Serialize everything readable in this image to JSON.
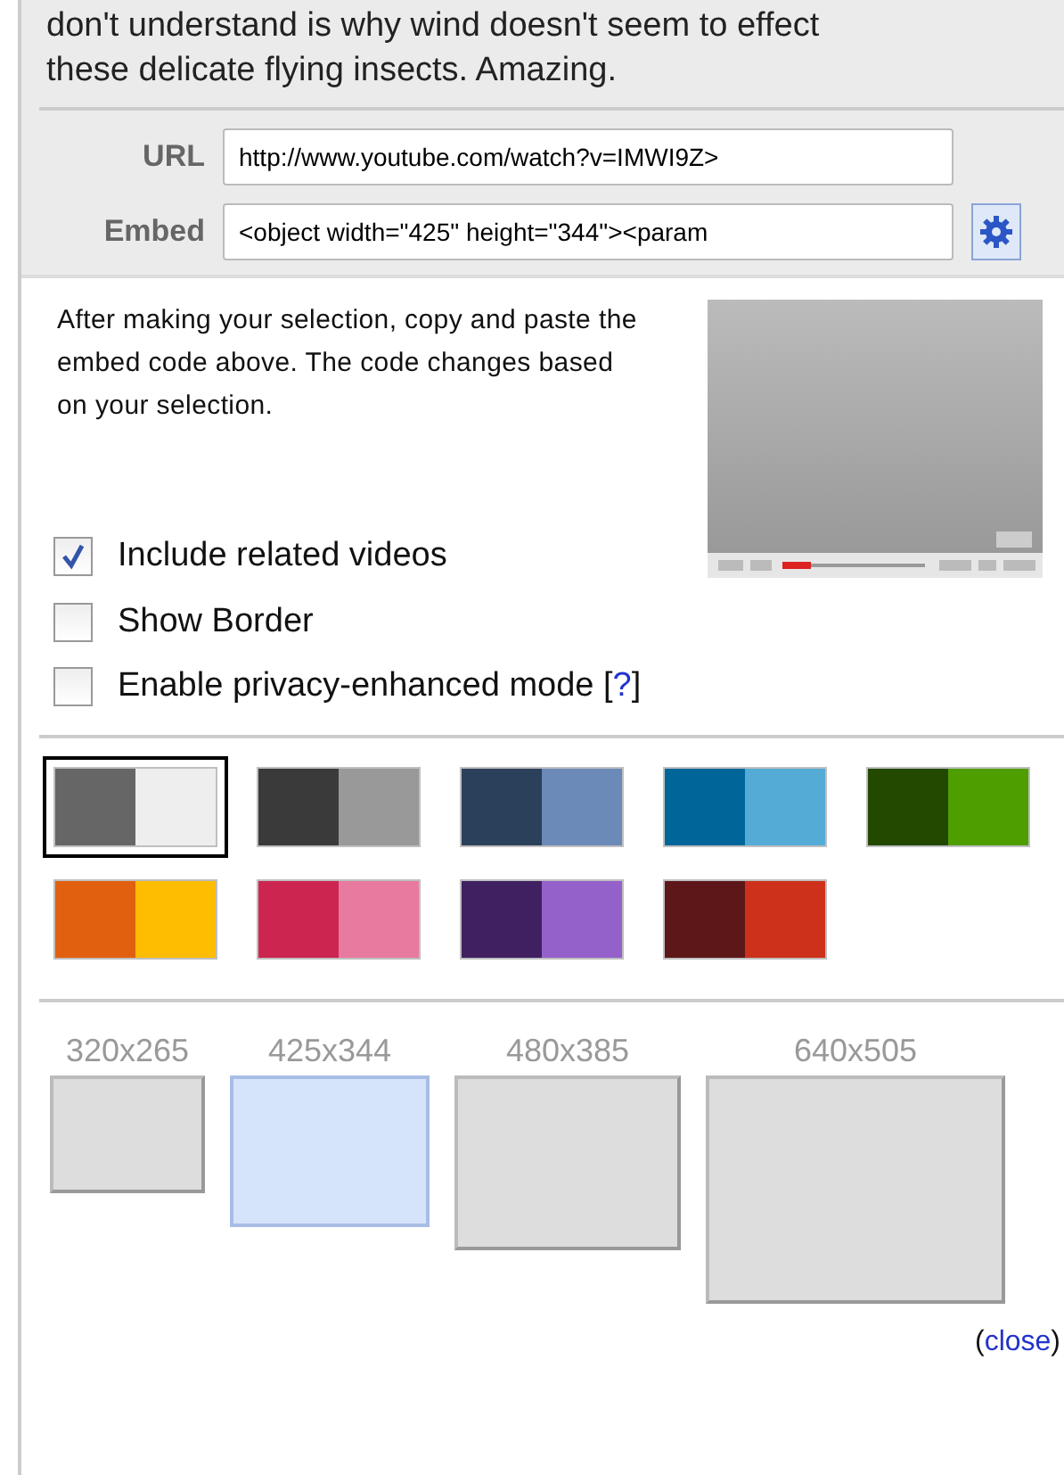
{
  "description": {
    "lines": [
      "don't understand is why wind doesn't seem to effect",
      "these delicate flying insects. Amazing."
    ]
  },
  "url_field": {
    "label": "URL",
    "value": "http://www.youtube.com/watch?v=IMWI9Z>"
  },
  "embed_field": {
    "label": "Embed",
    "value": "<object width=\"425\" height=\"344\"><param"
  },
  "note": "After making your selection, copy and paste the embed code above. The code changes based on your selection.",
  "options": [
    {
      "label": "Include related videos",
      "checked": true
    },
    {
      "label": "Show Border",
      "checked": false
    },
    {
      "label": "Enable privacy-enhanced mode [",
      "checked": false,
      "help": "?",
      "help_after": "]"
    }
  ],
  "color_schemes": [
    {
      "halves": [
        {
          "color": "#666666"
        },
        {
          "color": "#eeeeee"
        }
      ],
      "selected": true
    },
    {
      "halves": [
        {
          "color": "#3a3a3a"
        },
        {
          "color": "#999999"
        }
      ],
      "selected": false
    },
    {
      "halves": [
        {
          "color": "#2b405b"
        },
        {
          "color": "#6b8ab8"
        }
      ],
      "selected": false
    },
    {
      "halves": [
        {
          "color": "#006699"
        },
        {
          "color": "#54abd6"
        }
      ],
      "selected": false
    },
    {
      "halves": [
        {
          "color": "#234900"
        },
        {
          "color": "#4e9e00"
        }
      ],
      "selected": false
    },
    {
      "halves": [
        {
          "color": "#e1600f"
        },
        {
          "color": "#febd01"
        }
      ],
      "selected": false
    },
    {
      "halves": [
        {
          "color": "#cc2550"
        },
        {
          "color": "#e87a9f"
        }
      ],
      "selected": false
    },
    {
      "halves": [
        {
          "color": "#402061"
        },
        {
          "color": "#9461ca"
        }
      ],
      "selected": false
    },
    {
      "halves": [
        {
          "color": "#5d1719"
        },
        {
          "color": "#cd311b"
        }
      ],
      "selected": false
    }
  ],
  "sizes": [
    {
      "label": "320x265",
      "selected": false
    },
    {
      "label": "425x344",
      "selected": true
    },
    {
      "label": "480x385",
      "selected": false
    },
    {
      "label": "640x505",
      "selected": false
    }
  ],
  "close": {
    "before": "(",
    "link": "close",
    "after": ")"
  }
}
